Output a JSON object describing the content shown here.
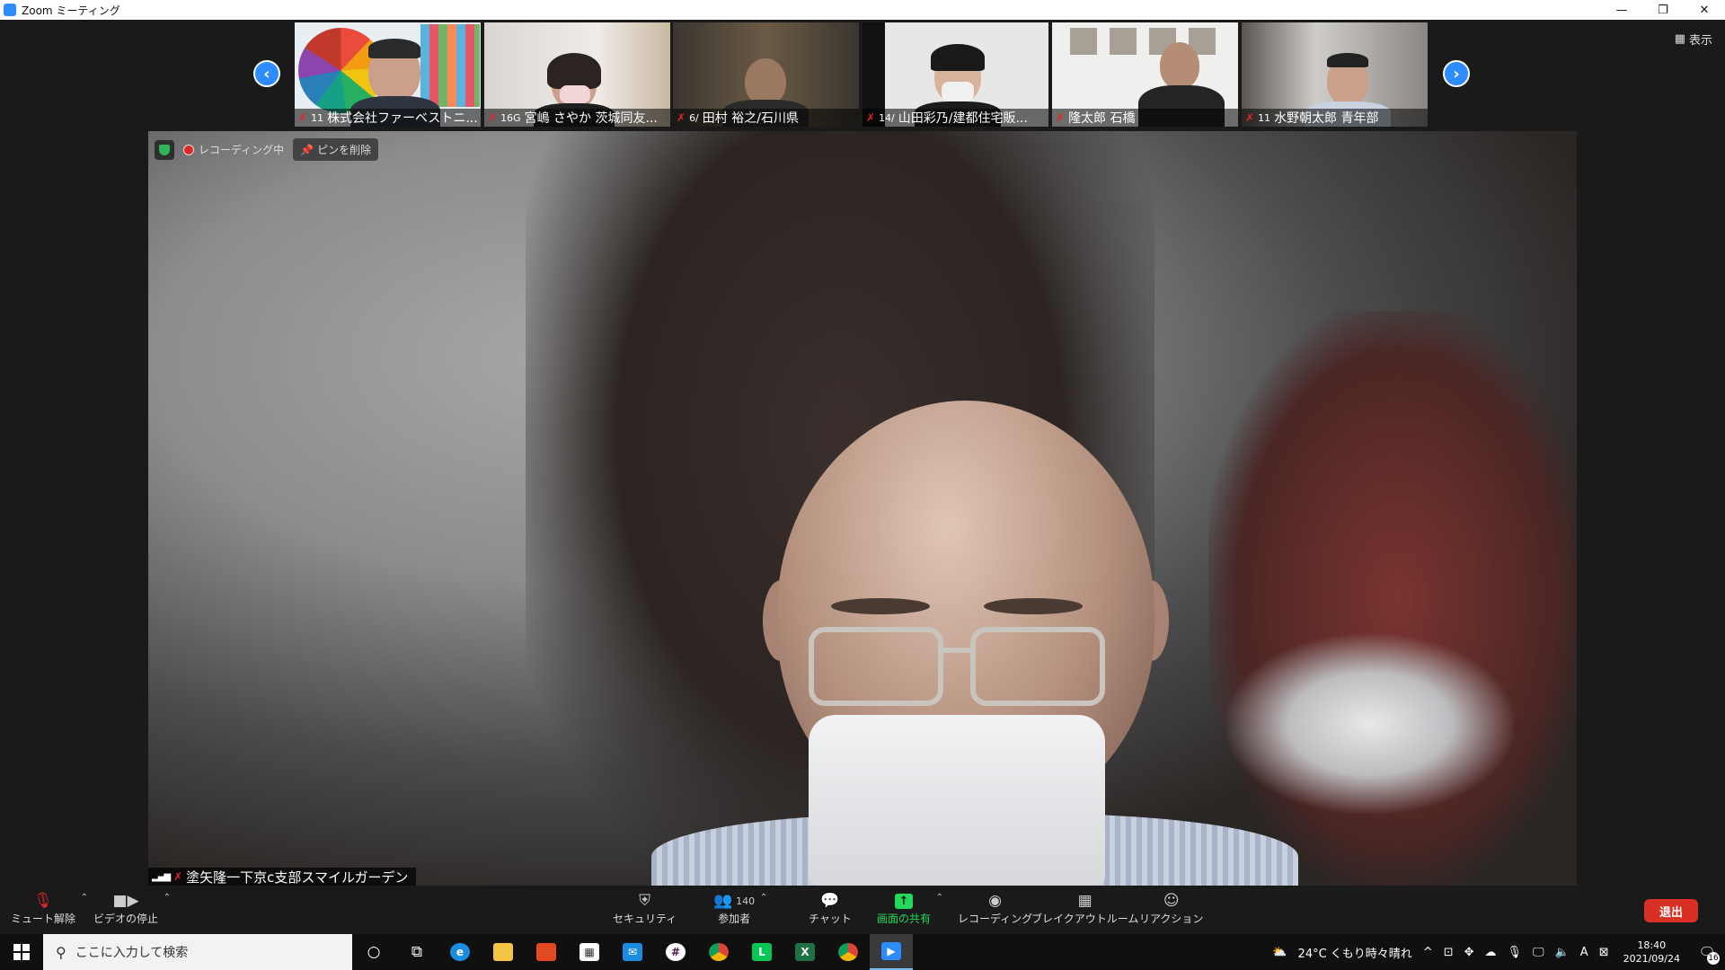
{
  "window": {
    "title": "Zoom ミーティング",
    "minimize": "—",
    "restore": "❐",
    "close": "✕"
  },
  "gallery": {
    "prev_icon": "chevron-left-icon",
    "next_icon": "chevron-right-icon",
    "prev_glyph": "‹",
    "next_glyph": "›",
    "view_label": "表示",
    "thumbnails": [
      {
        "num": "11",
        "name": "株式会社ファーベストニ..."
      },
      {
        "num": "16G",
        "name": "宮嶋 さやか 茨城同友..."
      },
      {
        "num": "6/",
        "name": "田村 裕之/石川県"
      },
      {
        "num": "14/",
        "name": "山田彩乃/建都住宅販..."
      },
      {
        "num": "",
        "name": "隆太郎 石橋"
      },
      {
        "num": "11",
        "name": "水野朝太郎 青年部"
      }
    ]
  },
  "main_video": {
    "recording_label": "レコーディング中",
    "unpin_label": "ピンを削除",
    "speaker_name": "塗矢隆一下京c支部スマイルガーデン"
  },
  "toolbar": {
    "unmute": "ミュート解除",
    "stop_video": "ビデオの停止",
    "security": "セキュリティ",
    "participants": "参加者",
    "participants_count": "140",
    "chat": "チャット",
    "share_screen": "画面の共有",
    "recording": "レコーディング",
    "breakout": "ブレイクアウトルーム",
    "reactions": "リアクション",
    "leave": "退出"
  },
  "taskbar": {
    "search_placeholder": "ここに入力して検索",
    "weather": "24°C くもり時々晴れ",
    "ime": "A",
    "time": "18:40",
    "date": "2021/09/24",
    "notif_count": "16"
  },
  "colors": {
    "zoom_blue": "#2d8cff",
    "leave_red": "#d93025",
    "share_green": "#23d959",
    "mic_red": "#e02828"
  }
}
